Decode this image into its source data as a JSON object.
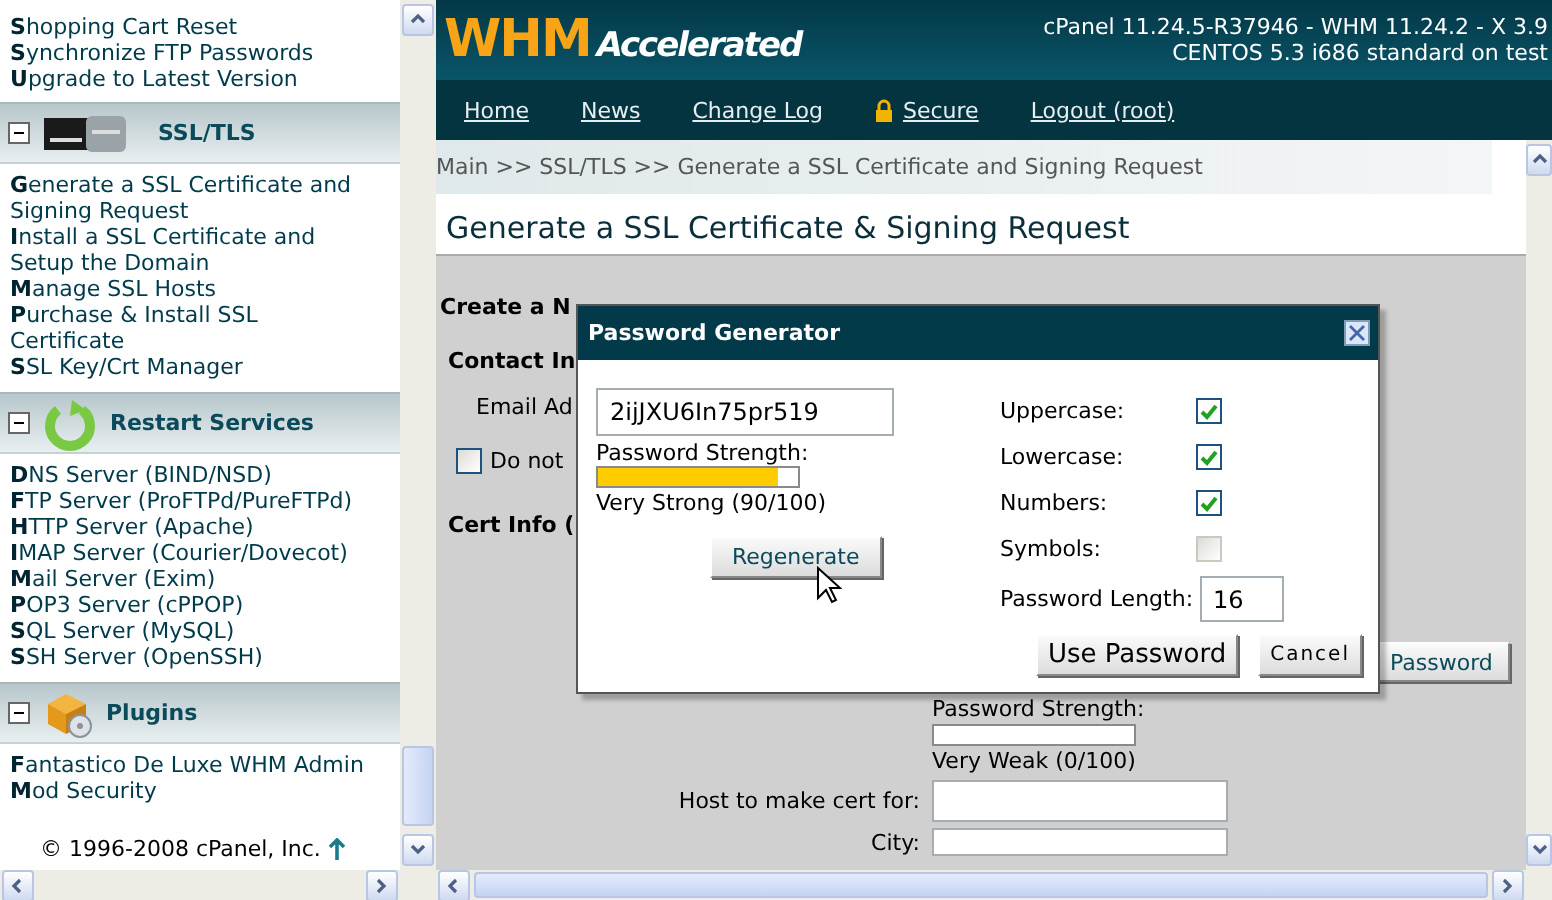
{
  "sidebar": {
    "sections": [
      {
        "items": [
          "**S**hopping Cart Reset",
          "**S**ynchronize FTP Passwords",
          "**U**pgrade to Latest Version"
        ]
      },
      {
        "title": "SSL/TLS",
        "kind": "ssl",
        "expanded": true,
        "items": [
          "**G**enerate a SSL Certificate and Signing Request",
          "**I**nstall a SSL Certificate and Setup the Domain",
          "**M**anage SSL Hosts",
          "**P**urchase & Install SSL Certificate",
          "**S**SL Key/Crt Manager"
        ]
      },
      {
        "title": "Restart Services",
        "kind": "restart",
        "expanded": true,
        "items": [
          "**D**NS Server (BIND/NSD)",
          "**F**TP Server (ProFTPd/PureFTPd)",
          "**H**TTP Server (Apache)",
          "**I**MAP Server (Courier/Dovecot)",
          "**M**ail Server (Exim)",
          "**P**OP3 Server (cPPOP)",
          "**S**QL Server (MySQL)",
          "**S**SH Server (OpenSSH)"
        ]
      },
      {
        "title": "Plugins",
        "kind": "plugins",
        "expanded": true,
        "items": [
          "**F**antastico De Luxe WHM Admin",
          "**M**od Security"
        ]
      }
    ],
    "copyright": "© 1996-2008 cPanel, Inc."
  },
  "header": {
    "logo_primary": "WHM",
    "logo_secondary": "Accelerated",
    "version_line_1": "cPanel 11.24.5-R37946 - WHM 11.24.2 - X 3.9",
    "version_line_2": "CENTOS 5.3 i686 standard on test"
  },
  "nav": [
    {
      "label": "Home",
      "kind": "plain"
    },
    {
      "label": "News",
      "kind": "plain"
    },
    {
      "label": "Change Log",
      "kind": "plain"
    },
    {
      "label": "Secure",
      "kind": "lock"
    },
    {
      "label": "Logout (root)",
      "kind": "plain"
    }
  ],
  "breadcrumb": "Main >> SSL/TLS >> Generate a SSL Certificate and Signing Request",
  "page_title": "Generate a SSL Certificate & Signing Request",
  "form": {
    "heading": "Create a N",
    "contact_heading": "Contact In",
    "email_label": "Email Ad",
    "no_email": {
      "label": "Do not",
      "checked": false
    },
    "cert_heading": "Cert Info (",
    "password_button": "Password",
    "strength_label": "Password Strength:",
    "strength_bar": {
      "level": 0
    },
    "strength_text": "Very Weak (0/100)",
    "host_label": "Host to make cert for:",
    "city_label": "City:"
  },
  "dialog": {
    "title": "Password Generator",
    "password": "2ijJXU6In75pr519",
    "strength_label": "Password Strength:",
    "strength_bar": {
      "level": 0.9
    },
    "strength_text": "Very Strong (90/100)",
    "regenerate": "Regenerate",
    "options": [
      {
        "label": "Uppercase:",
        "checked": true
      },
      {
        "label": "Lowercase:",
        "checked": true
      },
      {
        "label": "Numbers:",
        "checked": true
      },
      {
        "label": "Symbols:",
        "checked": false
      }
    ],
    "length_label": "Password Length:",
    "length": "16",
    "use_button": "Use Password",
    "cancel_button": "Cancel"
  }
}
